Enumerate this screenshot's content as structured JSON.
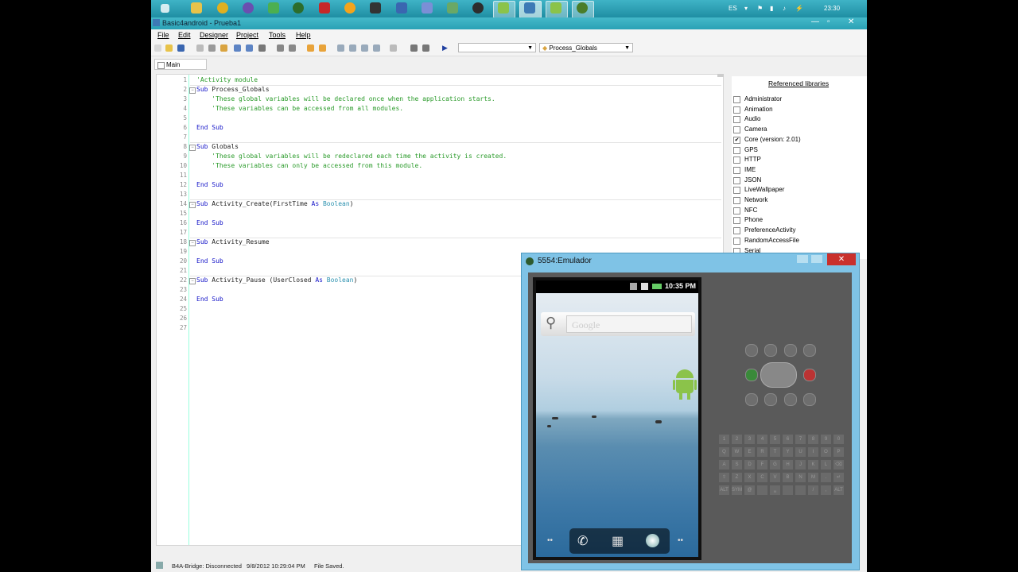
{
  "taskbar": {
    "tray_lang": "ES",
    "clock": "23:30"
  },
  "window": {
    "title": "Basic4android - Prueba1",
    "min": "—",
    "max": "▫",
    "close": "✕"
  },
  "menu": [
    "File",
    "Edit",
    "Designer",
    "Project",
    "Tools",
    "Help"
  ],
  "toolbar": {
    "combo_empty": "",
    "combo_sub": "Process_Globals"
  },
  "tabs": {
    "main": "Main"
  },
  "code": [
    {
      "n": "1",
      "parts": [
        [
          "cm",
          "'Activity module"
        ]
      ]
    },
    {
      "n": "2",
      "fold": "−",
      "parts": [
        [
          "kw",
          "Sub "
        ],
        [
          "id",
          "Process_Globals"
        ]
      ]
    },
    {
      "n": "3",
      "parts": [
        [
          "cm",
          "    'These global variables will be declared once when the application starts."
        ]
      ]
    },
    {
      "n": "4",
      "parts": [
        [
          "cm",
          "    'These variables can be accessed from all modules."
        ]
      ]
    },
    {
      "n": "5",
      "parts": []
    },
    {
      "n": "6",
      "parts": [
        [
          "kw",
          "End Sub"
        ]
      ]
    },
    {
      "n": "7",
      "parts": []
    },
    {
      "n": "8",
      "fold": "−",
      "parts": [
        [
          "kw",
          "Sub "
        ],
        [
          "id",
          "Globals"
        ]
      ]
    },
    {
      "n": "9",
      "parts": [
        [
          "cm",
          "    'These global variables will be redeclared each time the activity is created."
        ]
      ]
    },
    {
      "n": "10",
      "parts": [
        [
          "cm",
          "    'These variables can only be accessed from this module."
        ]
      ]
    },
    {
      "n": "11",
      "parts": []
    },
    {
      "n": "12",
      "parts": [
        [
          "kw",
          "End Sub"
        ]
      ]
    },
    {
      "n": "13",
      "parts": []
    },
    {
      "n": "14",
      "fold": "−",
      "parts": [
        [
          "kw",
          "Sub "
        ],
        [
          "id",
          "Activity_Create(FirstTime "
        ],
        [
          "kw",
          "As "
        ],
        [
          "ty",
          "Boolean"
        ],
        [
          "id",
          ")"
        ]
      ]
    },
    {
      "n": "15",
      "parts": []
    },
    {
      "n": "16",
      "parts": [
        [
          "kw",
          "End Sub"
        ]
      ]
    },
    {
      "n": "17",
      "parts": []
    },
    {
      "n": "18",
      "fold": "−",
      "parts": [
        [
          "kw",
          "Sub "
        ],
        [
          "id",
          "Activity_Resume"
        ]
      ]
    },
    {
      "n": "19",
      "parts": []
    },
    {
      "n": "20",
      "parts": [
        [
          "kw",
          "End Sub"
        ]
      ]
    },
    {
      "n": "21",
      "parts": []
    },
    {
      "n": "22",
      "fold": "−",
      "parts": [
        [
          "kw",
          "Sub "
        ],
        [
          "id",
          "Activity_Pause (UserClosed "
        ],
        [
          "kw",
          "As "
        ],
        [
          "ty",
          "Boolean"
        ],
        [
          "id",
          ")"
        ]
      ]
    },
    {
      "n": "23",
      "parts": []
    },
    {
      "n": "24",
      "parts": [
        [
          "kw",
          "End Sub"
        ]
      ]
    },
    {
      "n": "25",
      "parts": []
    },
    {
      "n": "26",
      "parts": []
    },
    {
      "n": "27",
      "parts": []
    }
  ],
  "libraries": {
    "title": "Referenced libraries",
    "items": [
      {
        "name": "Administrator",
        "checked": false
      },
      {
        "name": "Animation",
        "checked": false
      },
      {
        "name": "Audio",
        "checked": false
      },
      {
        "name": "Camera",
        "checked": false
      },
      {
        "name": "Core (version: 2.01)",
        "checked": true
      },
      {
        "name": "GPS",
        "checked": false
      },
      {
        "name": "HTTP",
        "checked": false
      },
      {
        "name": "IME",
        "checked": false
      },
      {
        "name": "JSON",
        "checked": false
      },
      {
        "name": "LiveWallpaper",
        "checked": false
      },
      {
        "name": "Network",
        "checked": false
      },
      {
        "name": "NFC",
        "checked": false
      },
      {
        "name": "Phone",
        "checked": false
      },
      {
        "name": "PreferenceActivity",
        "checked": false
      },
      {
        "name": "RandomAccessFile",
        "checked": false
      },
      {
        "name": "Serial",
        "checked": false
      }
    ]
  },
  "status": {
    "bridge": "B4A-Bridge: Disconnected",
    "date": "9/8/2012 10:29:04 PM",
    "saved": "File Saved."
  },
  "emulator": {
    "title": "5554:Emulador",
    "close": "✕",
    "clock": "10:35 PM",
    "search_placeholder": "Google",
    "keyboard_rows": [
      [
        "1",
        "2",
        "3",
        "4",
        "5",
        "6",
        "7",
        "8",
        "9",
        "0"
      ],
      [
        "Q",
        "W",
        "E",
        "R",
        "T",
        "Y",
        "U",
        "I",
        "O",
        "P"
      ],
      [
        "A",
        "S",
        "D",
        "F",
        "G",
        "H",
        "J",
        "K",
        "L",
        "⌫"
      ],
      [
        "⇧",
        "Z",
        "X",
        "C",
        "V",
        "B",
        "N",
        "M",
        ".",
        "↵"
      ],
      [
        "ALT",
        "SYM",
        "@",
        "",
        "␣",
        "",
        "",
        "/",
        ",",
        "ALT"
      ]
    ]
  }
}
